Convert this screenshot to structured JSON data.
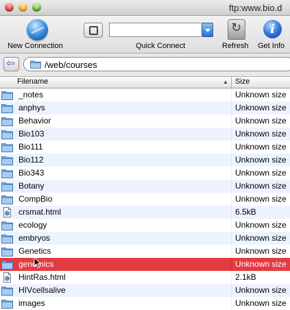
{
  "window": {
    "title": "ftp:www.bio.d"
  },
  "toolbar": {
    "new_connection_label": "New Connection",
    "quick_connect_label": "Quick Connect",
    "refresh_label": "Refresh",
    "get_info_label": "Get Info"
  },
  "path_bar": {
    "path": "/web/courses"
  },
  "table": {
    "columns": {
      "name": "Filename",
      "size": "Size"
    },
    "rows": [
      {
        "name": "_notes",
        "size": "Unknown size",
        "kind": "folder"
      },
      {
        "name": "anphys",
        "size": "Unknown size",
        "kind": "folder"
      },
      {
        "name": "Behavior",
        "size": "Unknown size",
        "kind": "folder"
      },
      {
        "name": "Bio103",
        "size": "Unknown size",
        "kind": "folder"
      },
      {
        "name": "Bio111",
        "size": "Unknown size",
        "kind": "folder"
      },
      {
        "name": "Bio112",
        "size": "Unknown size",
        "kind": "folder"
      },
      {
        "name": "Bio343",
        "size": "Unknown size",
        "kind": "folder"
      },
      {
        "name": "Botany",
        "size": "Unknown size",
        "kind": "folder"
      },
      {
        "name": "CompBio",
        "size": "Unknown size",
        "kind": "folder"
      },
      {
        "name": "crsmat.html",
        "size": "6.5kB",
        "kind": "file"
      },
      {
        "name": "ecology",
        "size": "Unknown size",
        "kind": "folder"
      },
      {
        "name": "embryos",
        "size": "Unknown size",
        "kind": "folder"
      },
      {
        "name": "Genetics",
        "size": "Unknown size",
        "kind": "folder"
      },
      {
        "name": "genomics",
        "size": "Unknown size",
        "kind": "folder",
        "selected": true
      },
      {
        "name": "HintRas.html",
        "size": "2.1kB",
        "kind": "file"
      },
      {
        "name": "HIVcellsalive",
        "size": "Unknown size",
        "kind": "folder"
      },
      {
        "name": "images",
        "size": "Unknown size",
        "kind": "folder"
      }
    ]
  },
  "icons": {
    "folder": "folder-icon",
    "file": "html-file-icon",
    "globe": "globe-icon",
    "refresh": "refresh-icon",
    "info": "info-icon"
  },
  "colors": {
    "selection": "#e43b41",
    "alt_row": "#edf3fe",
    "accent": "#2c6fd8"
  }
}
